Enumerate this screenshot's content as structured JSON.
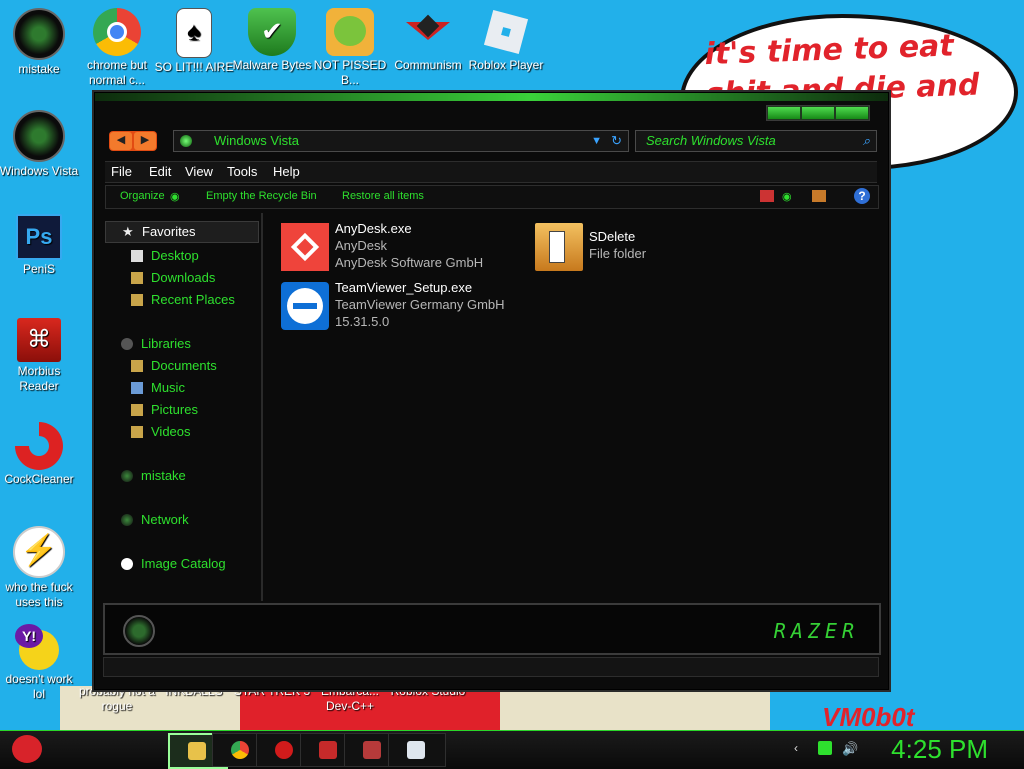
{
  "desktop": {
    "wallpaper_text": "it's time to eat shit and die and chew",
    "wallpaper_signature": "VM0b0t",
    "icons": [
      {
        "label": "mistake",
        "icon": "orb-icon"
      },
      {
        "label": "chrome but normal c...",
        "icon": "chrome-icon"
      },
      {
        "label": "SO LIT!!! AIRE",
        "icon": "solitaire-icon"
      },
      {
        "label": "Malware Bytes",
        "icon": "shield-icon"
      },
      {
        "label": "NOT PISSED B...",
        "icon": "angry-birds-pig-icon"
      },
      {
        "label": "Communism",
        "icon": "communism-icon"
      },
      {
        "label": "Roblox Player",
        "icon": "roblox-icon"
      },
      {
        "label": "Windows Vista",
        "icon": "orb-icon"
      },
      {
        "label": "PeniS",
        "icon": "photoshop-icon"
      },
      {
        "label": "Morbius Reader",
        "icon": "pdf-icon"
      },
      {
        "label": "CockCleaner",
        "icon": "ccleaner-icon"
      },
      {
        "label": "who the fuck uses this",
        "icon": "lightning-icon"
      },
      {
        "label": "doesn't work lol",
        "icon": "yahoo-icon"
      },
      {
        "label": "probably not a rogue",
        "icon": "game-icon"
      },
      {
        "label": "INKBALLS",
        "icon": "game-icon"
      },
      {
        "label": "STAR TREK 3",
        "icon": "game-icon"
      },
      {
        "label": "Embarca... Dev-C++",
        "icon": "devcpp-icon"
      },
      {
        "label": "Roblox Studio",
        "icon": "roblox-studio-icon"
      }
    ]
  },
  "explorer": {
    "nav_back": "◀",
    "nav_forward": "▶",
    "address": "Windows Vista",
    "search_placeholder": "Search Windows Vista",
    "menu": [
      "File",
      "Edit",
      "View",
      "Tools",
      "Help"
    ],
    "toolbar": {
      "organize": "Organize",
      "empty_bin": "Empty the Recycle Bin",
      "restore": "Restore all items",
      "help": "?"
    },
    "sidebar": {
      "favorites_header": "Favorites",
      "favorites": [
        "Desktop",
        "Downloads",
        "Recent Places"
      ],
      "libraries": "Libraries",
      "library_items": [
        "Documents",
        "Music",
        "Pictures",
        "Videos"
      ],
      "homegroup": "mistake",
      "network": "Network",
      "image_catalog": "Image Catalog"
    },
    "files": [
      {
        "name": "AnyDesk.exe",
        "line2": "AnyDesk",
        "line3": "AnyDesk Software GmbH",
        "icon": "anydesk-icon",
        "color": "#ef443b"
      },
      {
        "name": "SDelete",
        "line2": "File folder",
        "line3": "",
        "icon": "folder-icon",
        "color": "#e8a23a"
      },
      {
        "name": "TeamViewer_Setup.exe",
        "line2": "TeamViewer Germany GmbH",
        "line3": "15.31.5.0",
        "icon": "teamviewer-icon",
        "color": "#0e6fd6"
      }
    ],
    "brand": "RAZER"
  },
  "taskbar": {
    "clock": "4:25 PM",
    "buttons": [
      "explorer",
      "chrome",
      "opera",
      "dev-c++",
      "calendar",
      "notes"
    ]
  },
  "colors": {
    "accent_green": "#2ee02e",
    "desktop_blue": "#22b0ea"
  }
}
